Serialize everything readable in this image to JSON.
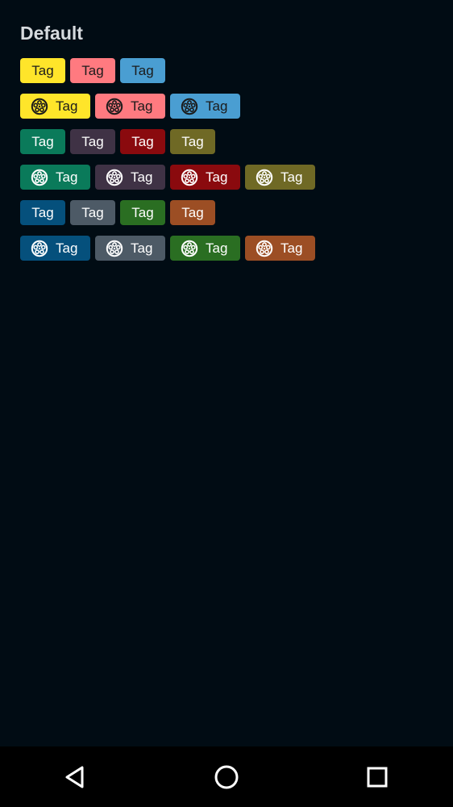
{
  "header": {
    "title": "Default"
  },
  "rows": [
    {
      "type": "plain",
      "tags": [
        {
          "label": "Tag",
          "bg": "#ffe52a",
          "fg": "#1b1b1b"
        },
        {
          "label": "Tag",
          "bg": "#ff7a80",
          "fg": "#1b1b1b"
        },
        {
          "label": "Tag",
          "bg": "#4a9ed2",
          "fg": "#1b1b1b"
        }
      ]
    },
    {
      "type": "icon",
      "tags": [
        {
          "label": "Tag",
          "bg": "#ffe52a",
          "fg": "#1b1b1b",
          "icon": "film-reel-icon"
        },
        {
          "label": "Tag",
          "bg": "#ff7a80",
          "fg": "#1b1b1b",
          "icon": "film-reel-icon"
        },
        {
          "label": "Tag",
          "bg": "#4a9ed2",
          "fg": "#1b1b1b",
          "icon": "film-reel-icon"
        }
      ]
    },
    {
      "type": "plain",
      "tags": [
        {
          "label": "Tag",
          "bg": "#0a7a5a",
          "fg": "#ffffff"
        },
        {
          "label": "Tag",
          "bg": "#3f3245",
          "fg": "#ffffff"
        },
        {
          "label": "Tag",
          "bg": "#8a0a0e",
          "fg": "#ffffff"
        },
        {
          "label": "Tag",
          "bg": "#6f6925",
          "fg": "#ffffff"
        }
      ]
    },
    {
      "type": "icon",
      "tags": [
        {
          "label": "Tag",
          "bg": "#0a7a5a",
          "fg": "#ffffff",
          "icon": "film-reel-icon"
        },
        {
          "label": "Tag",
          "bg": "#3f3245",
          "fg": "#ffffff",
          "icon": "film-reel-icon"
        },
        {
          "label": "Tag",
          "bg": "#8a0a0e",
          "fg": "#ffffff",
          "icon": "film-reel-icon"
        },
        {
          "label": "Tag",
          "bg": "#6f6925",
          "fg": "#ffffff",
          "icon": "film-reel-icon"
        }
      ]
    },
    {
      "type": "plain",
      "tags": [
        {
          "label": "Tag",
          "bg": "#05507c",
          "fg": "#ffffff"
        },
        {
          "label": "Tag",
          "bg": "#4d5a66",
          "fg": "#ffffff"
        },
        {
          "label": "Tag",
          "bg": "#2a6e22",
          "fg": "#ffffff"
        },
        {
          "label": "Tag",
          "bg": "#9c4e24",
          "fg": "#ffffff"
        }
      ]
    },
    {
      "type": "icon",
      "tags": [
        {
          "label": "Tag",
          "bg": "#05507c",
          "fg": "#ffffff",
          "icon": "film-reel-icon"
        },
        {
          "label": "Tag",
          "bg": "#4d5a66",
          "fg": "#ffffff",
          "icon": "film-reel-icon"
        },
        {
          "label": "Tag",
          "bg": "#2a6e22",
          "fg": "#ffffff",
          "icon": "film-reel-icon"
        },
        {
          "label": "Tag",
          "bg": "#9c4e24",
          "fg": "#ffffff",
          "icon": "film-reel-icon"
        }
      ]
    }
  ],
  "navbar": {
    "back_icon": "back-triangle-icon",
    "home_icon": "home-circle-icon",
    "recents_icon": "recents-square-icon"
  }
}
